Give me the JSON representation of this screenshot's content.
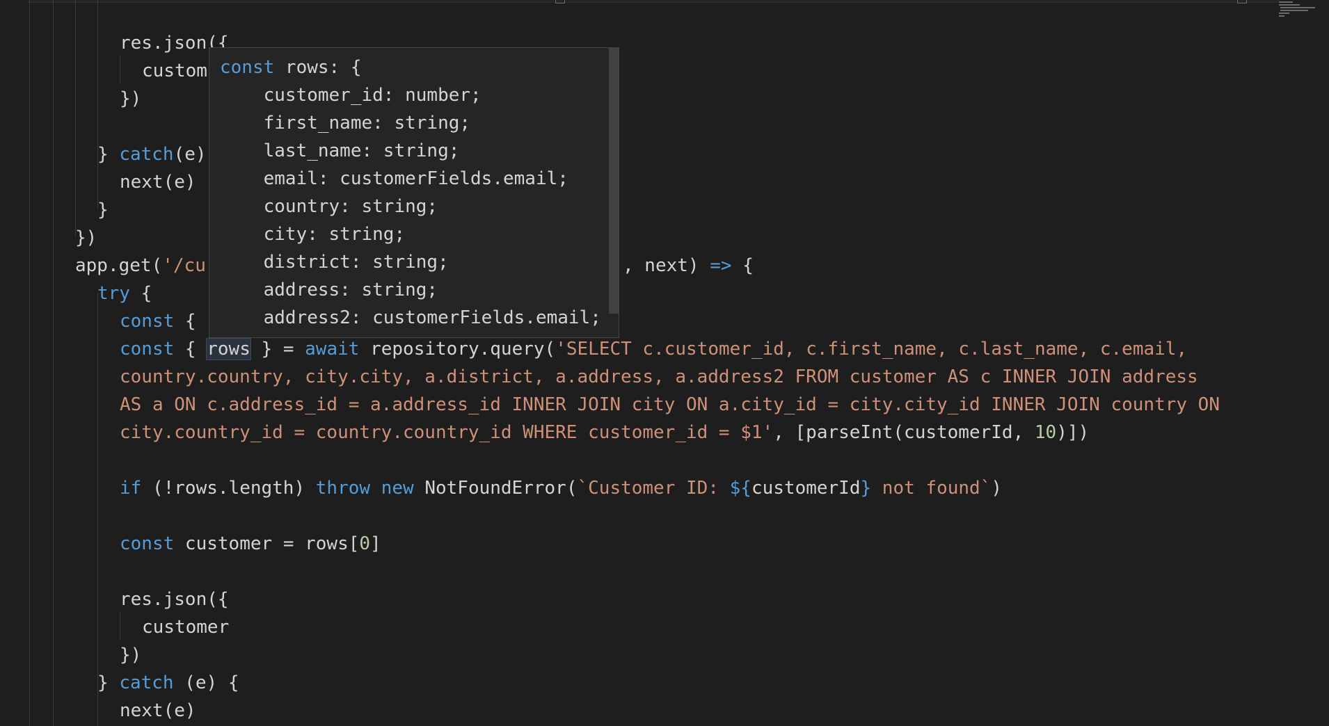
{
  "editor": {
    "lines": [
      "res.json({",
      "custom",
      "})",
      "} catch(e)",
      "next(e)",
      "}",
      "})",
      "app.get('/cu",
      ", next) => {",
      "try {",
      "const {",
      "const { rows } = await repository.query('SELECT c.customer_id, c.first_name, c.last_name, c.email,",
      "country.country, city.city, a.district, a.address, a.address2 FROM customer AS c INNER JOIN address",
      "AS a ON c.address_id = a.address_id INNER JOIN city ON a.city_id = city.city_id INNER JOIN country ON",
      "city.country_id = country.country_id WHERE customer_id = $1', [parseInt(customerId, 10)])",
      "if (!rows.length) throw new NotFoundError(`Customer ID: ${customerId} not found`)",
      "const customer = rows[0]",
      "res.json({",
      "customer",
      "})",
      "} catch (e) {",
      "next(e)"
    ]
  },
  "hover": {
    "lines": [
      "const rows: {",
      "    customer_id: number;",
      "    first_name: string;",
      "    last_name: string;",
      "    email: customerFields.email;",
      "    country: string;",
      "    city: string;",
      "    district: string;",
      "    address: string;",
      "    address2: customerFields.email;",
      "}[]"
    ]
  },
  "colors": {
    "background": "#1e1e1e",
    "keyword": "#569cd6",
    "string": "#ce9178",
    "number": "#b5cea8",
    "text": "#d4d4d4",
    "hover_background": "#252526"
  }
}
